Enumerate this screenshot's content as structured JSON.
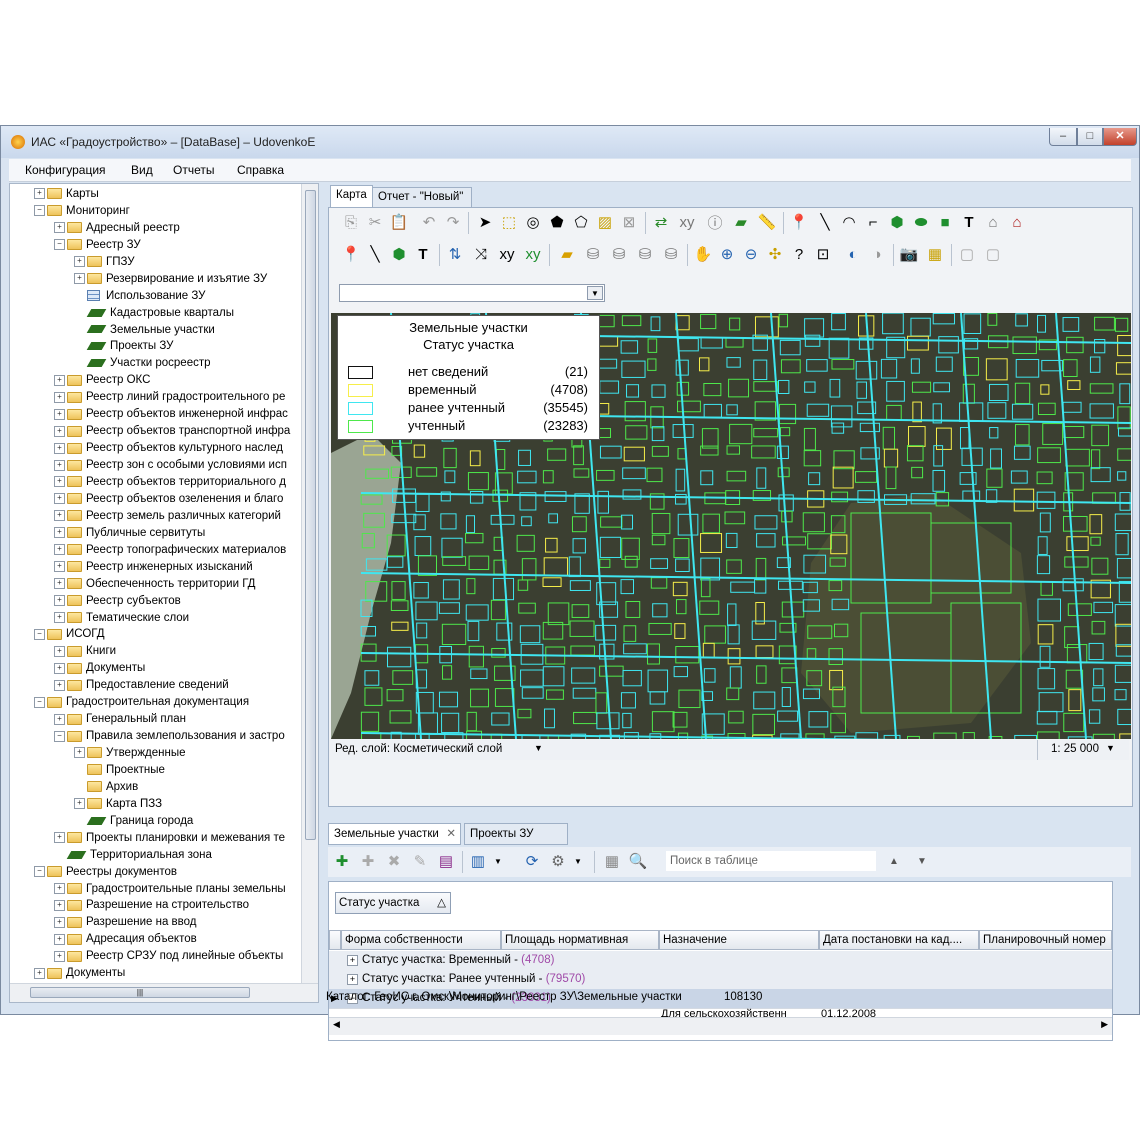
{
  "window": {
    "title": "ИАС «Градоустройство» – [DataBase] – UdovenkoE",
    "min": "–",
    "max": "□",
    "close": "✕"
  },
  "menu": [
    "Конфигурация",
    "Вид",
    "Отчеты",
    "Справка"
  ],
  "tree": [
    {
      "label": "Карты",
      "level": 1,
      "exp": "+",
      "icon": "folder"
    },
    {
      "label": "Мониторинг",
      "level": 1,
      "exp": "−",
      "icon": "folder"
    },
    {
      "label": "Адресный реестр",
      "level": 2,
      "exp": "+",
      "icon": "folder"
    },
    {
      "label": "Реестр ЗУ",
      "level": 2,
      "exp": "−",
      "icon": "folder"
    },
    {
      "label": "ГПЗУ",
      "level": 3,
      "exp": "+",
      "icon": "folder"
    },
    {
      "label": "Резервирование и изъятие ЗУ",
      "level": 3,
      "exp": "+",
      "icon": "folder"
    },
    {
      "label": "Использование ЗУ",
      "level": 3,
      "exp": "",
      "icon": "table"
    },
    {
      "label": "Кадастровые кварталы",
      "level": 3,
      "exp": "",
      "icon": "layer"
    },
    {
      "label": "Земельные участки",
      "level": 3,
      "exp": "",
      "icon": "layer"
    },
    {
      "label": "Проекты ЗУ",
      "level": 3,
      "exp": "",
      "icon": "layer"
    },
    {
      "label": "Участки росреестр",
      "level": 3,
      "exp": "",
      "icon": "layer"
    },
    {
      "label": "Реестр ОКС",
      "level": 2,
      "exp": "+",
      "icon": "folder"
    },
    {
      "label": "Реестр линий градостроительного ре",
      "level": 2,
      "exp": "+",
      "icon": "folder"
    },
    {
      "label": "Реестр объектов инженерной инфрас",
      "level": 2,
      "exp": "+",
      "icon": "folder"
    },
    {
      "label": "Реестр объектов транспортной инфра",
      "level": 2,
      "exp": "+",
      "icon": "folder"
    },
    {
      "label": "Реестр объектов культурного наслед",
      "level": 2,
      "exp": "+",
      "icon": "folder"
    },
    {
      "label": "Реестр зон с особыми условиями исп",
      "level": 2,
      "exp": "+",
      "icon": "folder"
    },
    {
      "label": "Реестр объектов территориального д",
      "level": 2,
      "exp": "+",
      "icon": "folder"
    },
    {
      "label": "Реестр объектов озеленения и благо",
      "level": 2,
      "exp": "+",
      "icon": "folder"
    },
    {
      "label": "Реестр земель различных категорий",
      "level": 2,
      "exp": "+",
      "icon": "folder"
    },
    {
      "label": "Публичные сервитуты",
      "level": 2,
      "exp": "+",
      "icon": "folder"
    },
    {
      "label": "Реестр топографических материалов",
      "level": 2,
      "exp": "+",
      "icon": "folder"
    },
    {
      "label": "Реестр инженерных изысканий",
      "level": 2,
      "exp": "+",
      "icon": "folder"
    },
    {
      "label": "Обеспеченность территории ГД",
      "level": 2,
      "exp": "+",
      "icon": "folder"
    },
    {
      "label": "Реестр субъектов",
      "level": 2,
      "exp": "+",
      "icon": "folder"
    },
    {
      "label": "Тематические слои",
      "level": 2,
      "exp": "+",
      "icon": "folder"
    },
    {
      "label": "ИСОГД",
      "level": 1,
      "exp": "−",
      "icon": "folder"
    },
    {
      "label": "Книги",
      "level": 2,
      "exp": "+",
      "icon": "folder"
    },
    {
      "label": "Документы",
      "level": 2,
      "exp": "+",
      "icon": "folder"
    },
    {
      "label": "Предоставление сведений",
      "level": 2,
      "exp": "+",
      "icon": "folder"
    },
    {
      "label": "Градостроительная документация",
      "level": 1,
      "exp": "−",
      "icon": "folder"
    },
    {
      "label": "Генеральный план",
      "level": 2,
      "exp": "+",
      "icon": "folder"
    },
    {
      "label": "Правила землепользования и застро",
      "level": 2,
      "exp": "−",
      "icon": "folder"
    },
    {
      "label": "Утвержденные",
      "level": 3,
      "exp": "+",
      "icon": "folder"
    },
    {
      "label": "Проектные",
      "level": 3,
      "exp": "",
      "icon": "folder"
    },
    {
      "label": "Архив",
      "level": 3,
      "exp": "",
      "icon": "folder"
    },
    {
      "label": "Карта ПЗЗ",
      "level": 3,
      "exp": "+",
      "icon": "folder"
    },
    {
      "label": "Граница города",
      "level": 3,
      "exp": "",
      "icon": "layer"
    },
    {
      "label": "Проекты планировки и межевания те",
      "level": 2,
      "exp": "+",
      "icon": "folder"
    },
    {
      "label": "Территориальная зона",
      "level": 2,
      "exp": "",
      "icon": "layer"
    },
    {
      "label": "Реестры документов",
      "level": 1,
      "exp": "−",
      "icon": "folder"
    },
    {
      "label": "Градостроительные планы земельны",
      "level": 2,
      "exp": "+",
      "icon": "folder"
    },
    {
      "label": "Разрешение на строительство",
      "level": 2,
      "exp": "+",
      "icon": "folder"
    },
    {
      "label": "Разрешение на ввод",
      "level": 2,
      "exp": "+",
      "icon": "folder"
    },
    {
      "label": "Адресация объектов",
      "level": 2,
      "exp": "+",
      "icon": "folder"
    },
    {
      "label": "Реестр СРЗУ под линейные объекты",
      "level": 2,
      "exp": "+",
      "icon": "folder"
    },
    {
      "label": "Документы",
      "level": 1,
      "exp": "+",
      "icon": "folder"
    }
  ],
  "tabs": {
    "map": "Карта",
    "report": "Отчет - \"Новый\""
  },
  "legend": {
    "title": "Земельные участки",
    "subtitle": "Статус участка",
    "rows": [
      {
        "label": "нет сведений",
        "count": "(21)",
        "color": "#111111"
      },
      {
        "label": "временный",
        "count": "(4708)",
        "color": "#f6ee4a"
      },
      {
        "label": "ранее учтенный",
        "count": "(35545)",
        "color": "#3fe6f0"
      },
      {
        "label": "учтенный",
        "count": "(23283)",
        "color": "#4ee84b"
      }
    ]
  },
  "map_status": {
    "edit_layer": "Ред. слой: Косметический слой",
    "scale": "1: 25 000"
  },
  "bottom_tabs": {
    "parcels": "Земельные участки",
    "projects": "Проекты ЗУ"
  },
  "search_placeholder": "Поиск в таблице",
  "group_by": "Статус участка",
  "columns": [
    "Форма собственности",
    "Площадь нормативная",
    "Назначение",
    "Дата постановки на кад....",
    "Планировочный номер"
  ],
  "groups": [
    {
      "label": "Статус участка: Временный",
      "count": "(4708)",
      "exp": "+"
    },
    {
      "label": "Статус участка: Ранее учтенный",
      "count": "(79570)",
      "exp": "+"
    },
    {
      "label": "Статус участка: Учтенный",
      "count": "(23831)",
      "exp": "−"
    }
  ],
  "partial_row": {
    "purpose": "Для сельскохозяйственн",
    "date": "01.12.2008"
  },
  "status": {
    "catalog": "Каталог: ГеоИС г. Омск\\Мониторинг\\Реестр ЗУ\\Земельные участки",
    "count": "108130"
  },
  "colors": {
    "parcel_cyan": "#3fe6f0",
    "parcel_green": "#4ee84b",
    "parcel_yellow": "#f6ee4a",
    "map_bg": "#3b3f31",
    "river": "#9aa593",
    "park": "#4b4e35"
  }
}
